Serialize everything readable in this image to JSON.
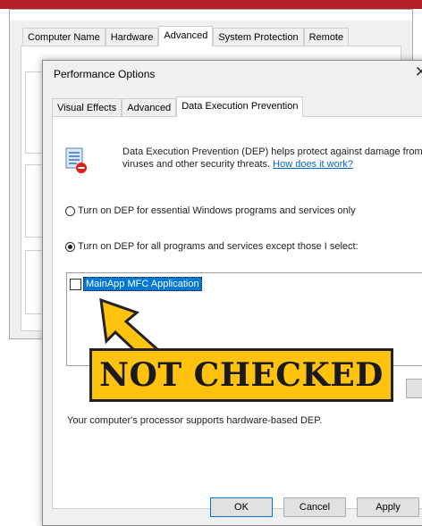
{
  "colors": {
    "top_stripe": "#b41f2a",
    "callout_fill": "#ffc20e",
    "selection": "#0078d7",
    "link": "#0066cc"
  },
  "system_properties": {
    "tabs": [
      "Computer Name",
      "Hardware",
      "Advanced",
      "System Protection",
      "Remote"
    ],
    "active_tab": "Advanced"
  },
  "performance_options": {
    "title": "Performance Options",
    "close_icon": "close-icon",
    "tabs": [
      "Visual Effects",
      "Advanced",
      "Data Execution Prevention"
    ],
    "active_tab": "Data Execution Prevention",
    "dep_icon": "dep-shield-icon",
    "description": "Data Execution Prevention (DEP) helps protect against damage from viruses and other security threats.",
    "link": "How does it work?",
    "radio_essential": "Turn on DEP for essential Windows programs and services only",
    "radio_all": "Turn on DEP for all programs and services except those I select:",
    "selected_option": "radio_all",
    "programs": [
      {
        "name": "MainApp MFC Application",
        "checked": false
      }
    ],
    "support_text": "Your computer's processor supports hardware-based DEP.",
    "buttons": {
      "ok": "OK",
      "cancel": "Cancel",
      "apply": "Apply"
    }
  },
  "callout": {
    "text": "NOT CHECKED"
  }
}
